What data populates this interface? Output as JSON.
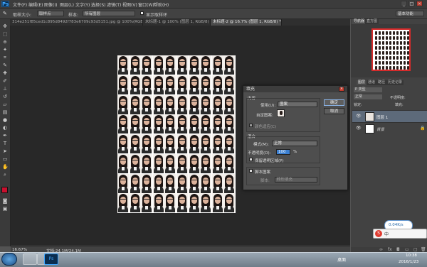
{
  "menubar": {
    "logo": "Ps",
    "items": [
      "文件(F)",
      "编辑(E)",
      "图像(I)",
      "图层(L)",
      "文字(Y)",
      "选择(S)",
      "滤镜(T)",
      "视图(V)",
      "窗口(W)",
      "帮助(H)"
    ],
    "window_buttons": [
      "_",
      "□",
      "×"
    ]
  },
  "optionsbar": {
    "sample_size_label": "取样大小:",
    "sample_size_value": "取样点",
    "sample_label": "样本:",
    "sample_value": "所有图层",
    "show_ring_label": "显示取样环",
    "show_ring_checked": true
  },
  "tabs": [
    {
      "label": "314e251f85ced1c895d8492f783e6709c93d5151.jpg @ 100%(RGB/8#)",
      "active": false
    },
    {
      "label": "未标题-1 @ 100% (图层 1, RGB/8) *",
      "active": false
    },
    {
      "label": "未标题-2 @ 16.7% (图层 1, RGB/8) *",
      "active": true
    }
  ],
  "status": {
    "zoom": "16.67%",
    "doc": "文档:24.1M/24.1M"
  },
  "panels": {
    "navigator_tabs": [
      "导航器",
      "直方图"
    ],
    "layers_tabs": [
      "图层",
      "通道",
      "路径",
      "历史记录"
    ],
    "search_label": "P 类型",
    "blend_mode": "正常",
    "opacity_label": "不透明度:",
    "lock_label": "锁定:",
    "fill_label": "填充:",
    "layers": [
      {
        "name": "图层 1",
        "selected": true
      },
      {
        "name": "背景",
        "selected": false
      }
    ],
    "essentials": "基本功能"
  },
  "dialog": {
    "title": "填充",
    "content_group": "内容",
    "use_label": "使用(U):",
    "use_value": "图案",
    "custom_pattern_label": "自定图案:",
    "script_label": "颜色适应(C)",
    "blending_group": "混合",
    "mode_label": "模式(M):",
    "mode_value": "正常",
    "opacity_label": "不透明度(O):",
    "opacity_value": "100",
    "opacity_unit": "%",
    "preserve_label": "保留透明区域(P)",
    "script_pattern_label": "脚本图案",
    "script_sub_label": "脚本:",
    "script_sub_value": "砖形填充",
    "ok": "确定",
    "cancel": "取消"
  },
  "taskbar": {
    "start": "",
    "apps": [
      "ie-icon",
      "folder-icon",
      "ps-icon"
    ],
    "desktop_label": "桌面",
    "time": "10:38",
    "date": "2016/1/23",
    "ime_label": "中",
    "net_speed": "0.04K/s"
  }
}
